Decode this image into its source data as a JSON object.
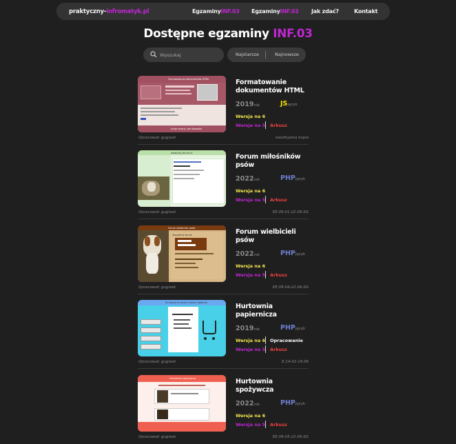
{
  "nav": {
    "brand_a": "praktyczny-",
    "brand_b": "infromatyk.pl",
    "link1_a": "Egzaminy",
    "link1_b": "INF.03",
    "link2_a": "Egzaminy",
    "link2_b": "INF.02",
    "link3": "Jak zdać?",
    "link4": "Kontakt"
  },
  "title_a": "Dostępne egzaminy ",
  "title_b": "INF.03",
  "search": {
    "placeholder": "Wyszukaj"
  },
  "sort": {
    "oldest": "Najstarsze",
    "newest": "Najnowsze"
  },
  "cards": [
    {
      "title": "Formatowanie dokumentów HTML",
      "year": "2019",
      "year_unit": "rok",
      "lang": "JS",
      "lang_unit": "język",
      "lang_color": "#f5e000",
      "w6": "Wersja na 6",
      "w5": "Wersja na 5",
      "ark": "Arkusz",
      "author": "Opracował: gugisek",
      "code": "nieoficjalna kopia",
      "thumb_header": "Formatowanie dokumentów HTML",
      "thumb_footer": "Autor strony: Jan Kowalski"
    },
    {
      "title": "Forum miłośników psów",
      "year": "2022",
      "year_unit": "rok",
      "lang": "PHP",
      "lang_unit": "język",
      "lang_color": "#6d7fcf",
      "w6": "Wersja na 6",
      "w5": "Wersja na 5",
      "ark": "Arkusz",
      "author": "Opracował: gugisek",
      "code": "EE.09-01-22.06-SG",
      "thumb_header": "www.psy-forum.pl"
    },
    {
      "title": "Forum wielbicieli psów",
      "year": "2022",
      "year_unit": "rok",
      "lang": "PHP",
      "lang_unit": "język",
      "lang_color": "#6d7fcf",
      "w6": "Wersja na 6",
      "w5": "Wersja na 5",
      "ark": "Arkusz",
      "author": "Opracował: gugisek",
      "code": "EE.09-04-22.06-SG",
      "thumb_header": "Forum wielbicieli psów",
      "thumb_sub": "Zapytania forum"
    },
    {
      "title": "Hurtownia papiernicza",
      "year": "2019",
      "year_unit": "rok",
      "lang": "PHP",
      "lang_unit": "język",
      "lang_color": "#6d7fcf",
      "w6": "Wersja na 6",
      "w5": "Wersja na 5",
      "ark": "Arkusz",
      "opr": "Opracowanie",
      "author": "Opracował: gugisek",
      "code": "E.14-02-19.06",
      "thumb_header": "W naszej hurtowni kupisz najtaniej"
    },
    {
      "title": "Hurtownia spożywcza",
      "year": "2022",
      "year_unit": "rok",
      "lang": "PHP",
      "lang_unit": "język",
      "lang_color": "#6d7fcf",
      "w6": "Wersja na 6",
      "w5": "Wersja na 5",
      "ark": "Arkusz",
      "author": "Opracował: gugisek",
      "code": "EE.09-05-22.06-SG",
      "thumb_header": "Hurtownia spożywcza"
    }
  ]
}
